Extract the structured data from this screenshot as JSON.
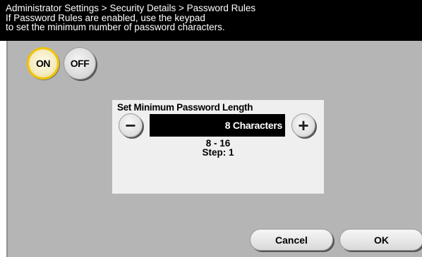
{
  "header": {
    "line1": "Administrator Settings > Security Details > Password Rules",
    "line2": "If Password Rules are enabled, use the keypad",
    "line3": "to set the minimum number of password characters."
  },
  "toggle": {
    "on_label": "ON",
    "off_label": "OFF",
    "selected": "ON"
  },
  "setting": {
    "title": "Set Minimum Password Length",
    "decrement_symbol": "−",
    "increment_symbol": "+",
    "value": "8 Characters",
    "range": "8 - 16",
    "step": "Step: 1"
  },
  "footer": {
    "cancel_label": "Cancel",
    "ok_label": "OK"
  },
  "colors": {
    "header_bg": "#000000",
    "panel_bg": "#b5b5b5",
    "dialog_bg": "#efefef",
    "selected_accent": "#f0c300"
  }
}
